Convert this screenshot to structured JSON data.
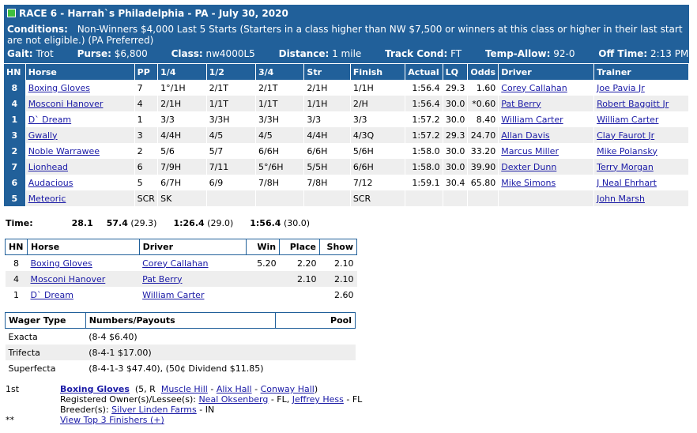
{
  "header": {
    "title": "RACE 6 - Harrah`s Philadelphia - PA - July 30, 2020",
    "conditions_label": "Conditions:",
    "conditions_text": "Non-Winners $4,000 Last 5 Starts (Starters in a class higher than NW $7,500 or winners at this class or higher in their last start are not eligible.) (PA Preferred)",
    "gait_label": "Gait:",
    "gait": "Trot",
    "purse_label": "Purse:",
    "purse": "$6,800",
    "class_label": "Class:",
    "class": "nw4000L5",
    "distance_label": "Distance:",
    "distance": "1 mile",
    "track_label": "Track Cond:",
    "track": "FT",
    "temp_label": "Temp-Allow:",
    "temp": "92-0",
    "off_label": "Off Time:",
    "off": "2:13 PM"
  },
  "main_table": {
    "columns": [
      "HN",
      "Horse",
      "PP",
      "1/4",
      "1/2",
      "3/4",
      "Str",
      "Finish",
      "Actual",
      "LQ",
      "Odds",
      "Driver",
      "Trainer"
    ],
    "rows": [
      {
        "hn": "8",
        "horse": "Boxing Gloves",
        "pp": "7",
        "q1": "1°/1H",
        "q2": "2/1T",
        "q3": "2/1T",
        "str": "2/1H",
        "fin": "1/1H",
        "act": "1:56.4",
        "lq": "29.3",
        "odds": "1.60",
        "driver": "Corey Callahan",
        "trainer": "Joe Pavia Jr"
      },
      {
        "hn": "4",
        "horse": "Mosconi Hanover",
        "pp": "4",
        "q1": "2/1H",
        "q2": "1/1T",
        "q3": "1/1T",
        "str": "1/1H",
        "fin": "2/H",
        "act": "1:56.4",
        "lq": "30.0",
        "odds": "*0.60",
        "driver": "Pat Berry",
        "trainer": "Robert Baggitt Jr"
      },
      {
        "hn": "1",
        "horse": "D` Dream",
        "pp": "1",
        "q1": "3/3",
        "q2": "3/3H",
        "q3": "3/3H",
        "str": "3/3",
        "fin": "3/3",
        "act": "1:57.2",
        "lq": "30.0",
        "odds": "8.40",
        "driver": "William Carter",
        "trainer": "William Carter"
      },
      {
        "hn": "3",
        "horse": "Gwally",
        "pp": "3",
        "q1": "4/4H",
        "q2": "4/5",
        "q3": "4/5",
        "str": "4/4H",
        "fin": "4/3Q",
        "act": "1:57.2",
        "lq": "29.3",
        "odds": "24.70",
        "driver": "Allan Davis",
        "trainer": "Clay Faurot Jr"
      },
      {
        "hn": "2",
        "horse": "Noble Warrawee",
        "pp": "2",
        "q1": "5/6",
        "q2": "5/7",
        "q3": "6/6H",
        "str": "6/6H",
        "fin": "5/6H",
        "act": "1:58.0",
        "lq": "30.0",
        "odds": "33.20",
        "driver": "Marcus Miller",
        "trainer": "Mike Polansky"
      },
      {
        "hn": "7",
        "horse": "Lionhead",
        "pp": "6",
        "q1": "7/9H",
        "q2": "7/11",
        "q3": "5°/6H",
        "str": "5/5H",
        "fin": "6/6H",
        "act": "1:58.0",
        "lq": "30.0",
        "odds": "39.90",
        "driver": "Dexter Dunn",
        "trainer": "Terry Morgan"
      },
      {
        "hn": "6",
        "horse": "Audacious",
        "pp": "5",
        "q1": "6/7H",
        "q2": "6/9",
        "q3": "7/8H",
        "str": "7/8H",
        "fin": "7/12",
        "act": "1:59.1",
        "lq": "30.4",
        "odds": "65.80",
        "driver": "Mike Simons",
        "trainer": "J Neal Ehrhart"
      },
      {
        "hn": "5",
        "horse": "Meteoric",
        "pp": "SCR",
        "q1": "SK",
        "q2": "",
        "q3": "",
        "str": "",
        "fin": "SCR",
        "act": "",
        "lq": "",
        "odds": "",
        "driver": "",
        "trainer": "John Marsh"
      }
    ]
  },
  "times": {
    "label": "Time:",
    "t1": "28.1",
    "t2": "57.4",
    "t2p": "(29.3)",
    "t3": "1:26.4",
    "t3p": "(29.0)",
    "t4": "1:56.4",
    "t4p": "(30.0)"
  },
  "payout_table": {
    "columns": [
      "HN",
      "Horse",
      "Driver",
      "Win",
      "Place",
      "Show"
    ],
    "rows": [
      {
        "hn": "8",
        "horse": "Boxing Gloves",
        "driver": "Corey Callahan",
        "win": "5.20",
        "place": "2.20",
        "show": "2.10"
      },
      {
        "hn": "4",
        "horse": "Mosconi Hanover",
        "driver": "Pat Berry",
        "win": "",
        "place": "2.10",
        "show": "2.10"
      },
      {
        "hn": "1",
        "horse": "D` Dream",
        "driver": "William Carter",
        "win": "",
        "place": "",
        "show": "2.60"
      }
    ]
  },
  "wager_table": {
    "columns": [
      "Wager Type",
      "Numbers/Payouts",
      "Pool"
    ],
    "rows": [
      {
        "type": "Exacta",
        "payout": "(8-4 $6.40)"
      },
      {
        "type": "Trifecta",
        "payout": "(8-4-1 $17.00)"
      },
      {
        "type": "Superfecta",
        "payout": "(8-4-1-3 $47.40), (50¢ Dividend $11.85)"
      }
    ]
  },
  "details": {
    "rank": "1st",
    "stars": "**",
    "horse": "Boxing Gloves",
    "age_sex": "(5, R",
    "sire": "Muscle Hill",
    "dam": "Alix Hall",
    "damsire": "Conway Hall",
    "owners_label": "Registered Owner(s)/Lessee(s):",
    "owner1": "Neal Oksenberg",
    "owner1_loc": "- FL,",
    "owner2": "Jeffrey Hess",
    "owner2_loc": "- FL",
    "breeder_label": "Breeder(s):",
    "breeder": "Silver Linden Farms",
    "breeder_loc": "- IN",
    "top3_link": "View Top 3 Finishers (+)"
  }
}
